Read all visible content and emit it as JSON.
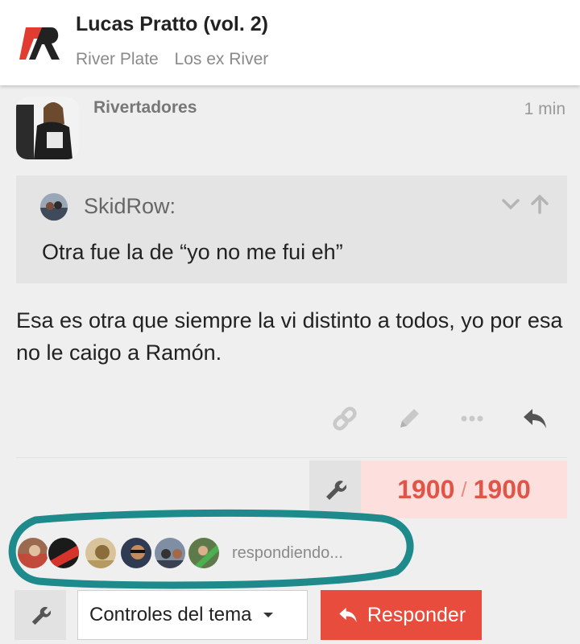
{
  "header": {
    "title": "Lucas Pratto (vol. 2)",
    "breadcrumbs": [
      "River Plate",
      "Los ex River"
    ],
    "logo_icon": "forum-logo-icon",
    "brand_color": "#e03c32"
  },
  "post": {
    "username": "Rivertadores",
    "time": "1 min",
    "quote": {
      "author": "SkidRow:",
      "text": "Otra fue la de “yo no me fui eh”"
    },
    "body": "Esa es otra que siempre la vi distinto a todos, yo por esa no le caigo a Ramón.",
    "actions": [
      "link-icon",
      "pencil-icon",
      "more-icon",
      "reply-icon"
    ]
  },
  "progress": {
    "current": "1900",
    "separator": "/",
    "total": "1900"
  },
  "replying": {
    "text": "respondiendo...",
    "avatar_count": 6
  },
  "footer": {
    "topic_controls_label": "Controles del tema",
    "reply_label": "Responder",
    "reply_color": "#e74c3c"
  }
}
